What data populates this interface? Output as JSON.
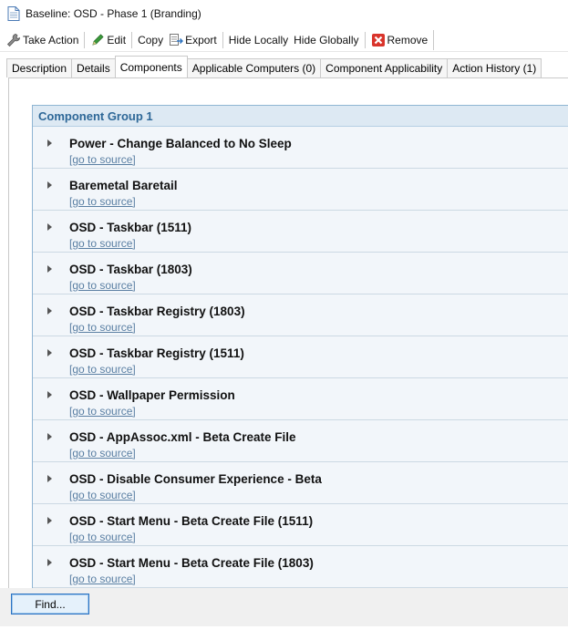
{
  "window": {
    "title": "Baseline: OSD - Phase 1 (Branding)"
  },
  "toolbar": {
    "take_action": "Take Action",
    "edit": "Edit",
    "copy": "Copy",
    "export": "Export",
    "hide_locally": "Hide Locally",
    "hide_globally": "Hide Globally",
    "remove": "Remove"
  },
  "tabs": [
    {
      "label": "Description"
    },
    {
      "label": "Details"
    },
    {
      "label": "Components"
    },
    {
      "label": "Applicable Computers (0)"
    },
    {
      "label": "Component Applicability"
    },
    {
      "label": "Action History (1)"
    }
  ],
  "active_tab": "Components",
  "group": {
    "title": "Component Group 1",
    "link_label": "[go to source]",
    "items": [
      {
        "name": "Power - Change Balanced to No Sleep"
      },
      {
        "name": "Baremetal Baretail"
      },
      {
        "name": "OSD - Taskbar (1511)"
      },
      {
        "name": "OSD - Taskbar (1803)"
      },
      {
        "name": "OSD - Taskbar Registry (1803)"
      },
      {
        "name": "OSD - Taskbar Registry (1511)"
      },
      {
        "name": "OSD - Wallpaper Permission"
      },
      {
        "name": "OSD - AppAssoc.xml - Beta Create File"
      },
      {
        "name": "OSD - Disable Consumer Experience - Beta"
      },
      {
        "name": "OSD - Start Menu - Beta Create File (1511)"
      },
      {
        "name": "OSD - Start Menu - Beta Create File (1803)"
      }
    ]
  },
  "footer": {
    "find_label": "Find..."
  },
  "colors": {
    "accent": "#2d6797",
    "link": "#5a7fa3",
    "remove": "#d9342b",
    "edit": "#3a9a3a"
  }
}
